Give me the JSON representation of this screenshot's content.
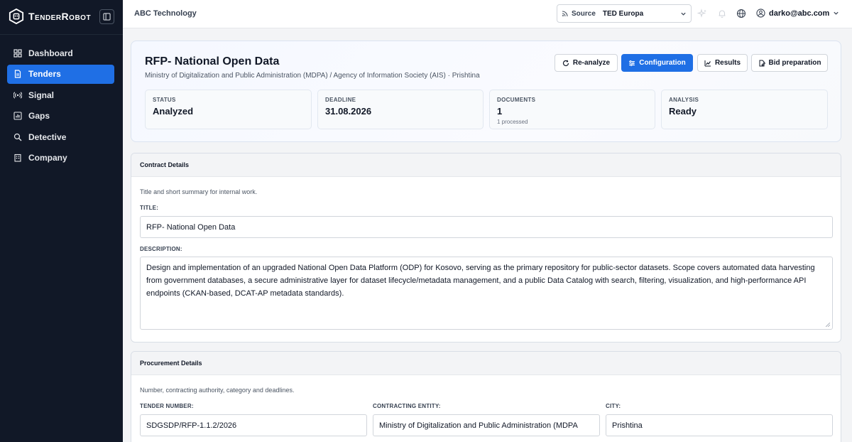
{
  "sidebar": {
    "brand": "TenderRobot",
    "items": [
      {
        "label": "Dashboard",
        "icon": "dashboard-icon",
        "active": false
      },
      {
        "label": "Tenders",
        "icon": "document-icon",
        "active": true
      },
      {
        "label": "Signal",
        "icon": "signal-icon",
        "active": false
      },
      {
        "label": "Gaps",
        "icon": "chart-icon",
        "active": false
      },
      {
        "label": "Detective",
        "icon": "detective-icon",
        "active": false
      },
      {
        "label": "Company",
        "icon": "building-icon",
        "active": false
      }
    ]
  },
  "topbar": {
    "org": "ABC Technology",
    "source_label": "Source",
    "source_value": "TED Europa",
    "user_email": "darko@abc.com"
  },
  "tender": {
    "title": "RFP- National Open Data",
    "subtitle": "Ministry of Digitalization and Public Administration (MDPA) / Agency of Information Society (AIS) · Prishtina",
    "actions": {
      "reanalyze": "Re-analyze",
      "configuration": "Configuration",
      "results": "Results",
      "bid": "Bid preparation"
    },
    "stats": [
      {
        "label": "STATUS",
        "value": "Analyzed",
        "note": ""
      },
      {
        "label": "DEADLINE",
        "value": "31.08.2026",
        "note": ""
      },
      {
        "label": "DOCUMENTS",
        "value": "1",
        "note": "1 processed"
      },
      {
        "label": "ANALYSIS",
        "value": "Ready",
        "note": ""
      }
    ]
  },
  "contract": {
    "heading": "Contract Details",
    "description": "Title and short summary for internal work.",
    "title_label": "TITLE:",
    "title_value": "RFP- National Open Data",
    "desc_label": "DESCRIPTION:",
    "desc_value": "Design and implementation of an upgraded National Open Data Platform (ODP) for Kosovo, serving as the primary repository for public-sector datasets. Scope covers automated data harvesting from government databases, a secure administrative layer for dataset lifecycle/metadata management, and a public Data Catalog with search, filtering, visualization, and high-performance API endpoints (CKAN-based, DCAT-AP metadata standards)."
  },
  "procurement": {
    "heading": "Procurement Details",
    "description": "Number, contracting authority, category and deadlines.",
    "tender_number_label": "TENDER NUMBER:",
    "tender_number": "SDGSDP/RFP-1.1.2/2026",
    "entity_label": "CONTRACTING ENTITY:",
    "entity": "Ministry of Digitalization and Public Administration (MDPA",
    "city_label": "CITY:",
    "city": "Prishtina"
  },
  "colors": {
    "sidebar_bg": "#111827",
    "accent": "#1f6fe5"
  }
}
